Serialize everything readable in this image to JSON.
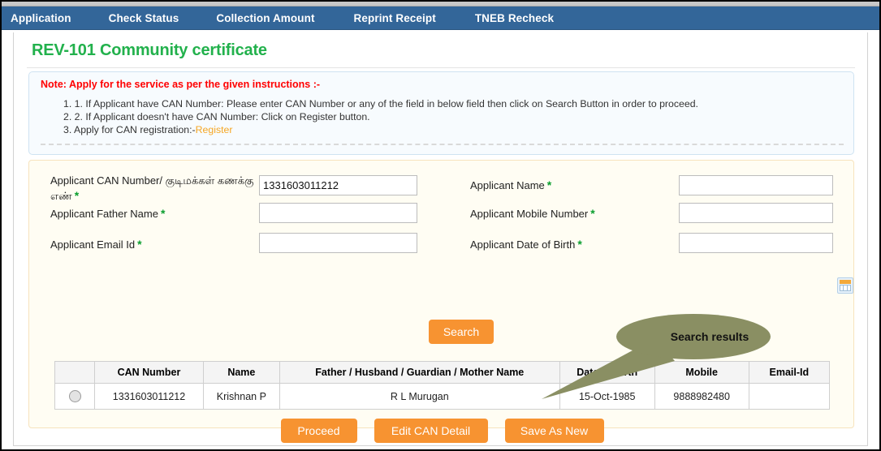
{
  "navbar": {
    "items": [
      {
        "label": "Application"
      },
      {
        "label": "Check Status"
      },
      {
        "label": "Collection Amount"
      },
      {
        "label": "Reprint Receipt"
      },
      {
        "label": "TNEB Recheck"
      }
    ],
    "background_color": "#336699"
  },
  "page": {
    "title": "REV-101 Community certificate",
    "title_color": "#22b14c"
  },
  "note": {
    "heading": "Note: Apply for the service as per the given instructions :-",
    "heading_color": "#ff0000",
    "items": [
      "1. 1. If Applicant have CAN Number: Please enter CAN Number or any of the field in below field then click on Search Button in order to proceed.",
      "2. 2. If Applicant doesn't have CAN Number: Click on Register button.",
      "3. Apply for CAN registration:-"
    ],
    "link_label": "Register",
    "link_color": "#f5a623"
  },
  "form": {
    "required_marker": "*",
    "fields": {
      "can_number": {
        "label": "Applicant CAN Number/ குடிமக்கள் கணக்கு எண்",
        "value": "1331603011212",
        "placeholder": ""
      },
      "father_name": {
        "label": "Applicant Father Name",
        "value": "",
        "placeholder": ""
      },
      "email_id": {
        "label": "Applicant Email Id",
        "value": "",
        "placeholder": ""
      },
      "applicant_name": {
        "label": "Applicant Name",
        "value": "",
        "placeholder": ""
      },
      "mobile_number": {
        "label": "Applicant Mobile Number",
        "value": "",
        "placeholder": ""
      },
      "date_of_birth": {
        "label": "Applicant Date of Birth",
        "value": "",
        "placeholder": ""
      }
    },
    "search_button": "Search",
    "button_color": "#f79331"
  },
  "results_table": {
    "headers": [
      "",
      "CAN Number",
      "Name",
      "Father / Husband / Guardian / Mother Name",
      "Date of Birth",
      "Mobile",
      "Email-Id"
    ],
    "rows": [
      {
        "selected": false,
        "can_number": "1331603011212",
        "name": "Krishnan P",
        "father_name": "R L Murugan",
        "date_of_birth": "15-Oct-1985",
        "mobile": "9888982480",
        "email_id": ""
      }
    ]
  },
  "actions": {
    "proceed": "Proceed",
    "edit_can_detail": "Edit CAN Detail",
    "save_as_new": "Save As New"
  },
  "callout": {
    "label": "Search results",
    "fill_color": "#8a8f63"
  }
}
